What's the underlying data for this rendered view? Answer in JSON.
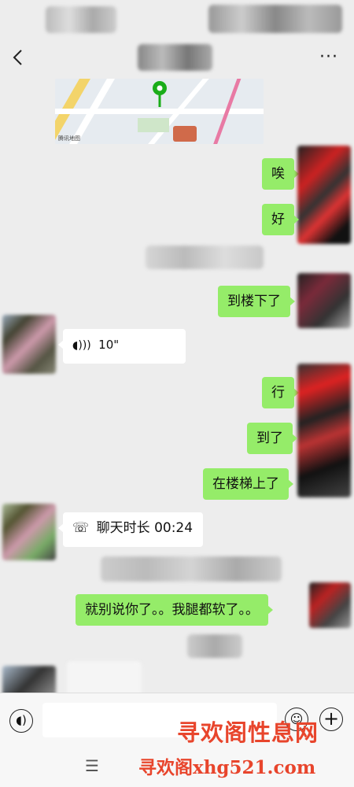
{
  "header": {
    "back_icon": "chevron-left-icon",
    "more_label": "···"
  },
  "map": {
    "pin_icon": "location-pin-icon",
    "logo_text": "腾讯地图"
  },
  "messages": {
    "m1": "唉",
    "m2": "好",
    "m3": "到楼下了",
    "voice_duration": "10\"",
    "m5": "行",
    "m6": "到了",
    "m7": "在楼梯上了",
    "call_duration": "聊天时长 00:24",
    "m9": "就别说你了。。我腿都软了。。"
  },
  "input_bar": {
    "voice_icon": "voice-input-icon",
    "emoji_icon": "emoji-icon",
    "plus_icon": "plus-icon",
    "input_value": ""
  },
  "nav": {
    "menu_label": "☰"
  },
  "watermark": {
    "line1": "寻欢阁性息网",
    "line2": "寻欢阁xhg521.com"
  },
  "colors": {
    "self_bubble": "#95ec69",
    "other_bubble": "#ffffff",
    "background": "#ededed",
    "watermark": "#e8452c"
  }
}
